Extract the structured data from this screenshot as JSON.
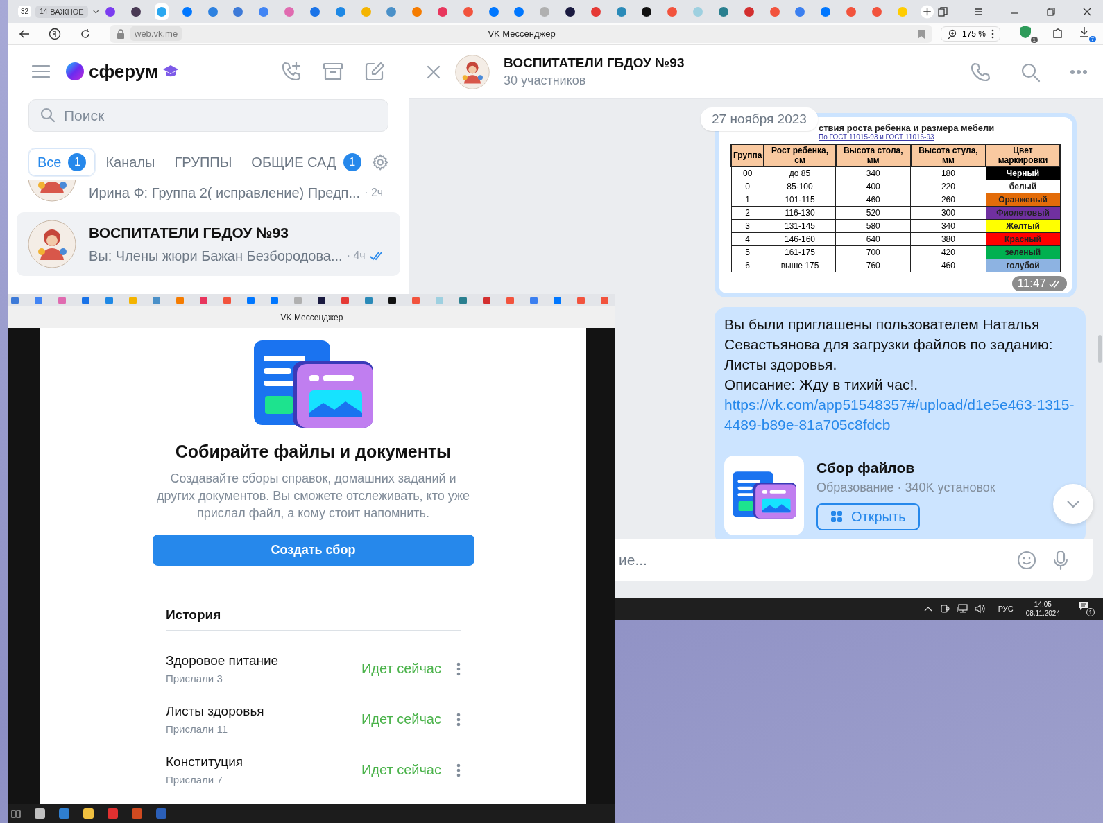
{
  "browser": {
    "tab_counter": "32",
    "tab_group": {
      "count": "14",
      "label": "ВАЖНОЕ"
    },
    "tabs": [
      {
        "color": "#7b3cf0",
        "selected": false
      },
      {
        "color": "#4a3a55",
        "selected": false
      },
      {
        "color": "#2aa7f0",
        "selected": true
      },
      {
        "color": "#0077ff",
        "selected": false
      },
      {
        "color": "#2d81e0",
        "selected": false
      },
      {
        "color": "#3d7ad8",
        "selected": false
      },
      {
        "color": "#4285f4",
        "selected": false
      },
      {
        "color": "#e06bb0",
        "selected": false
      },
      {
        "color": "#1a73e8",
        "selected": false
      },
      {
        "color": "#1e88e5",
        "selected": false
      },
      {
        "color": "#f4b400",
        "selected": false
      },
      {
        "color": "#4a90c8",
        "selected": false
      },
      {
        "color": "#f57c00",
        "selected": false
      },
      {
        "color": "#e8365d",
        "selected": false
      },
      {
        "color": "#f2533d",
        "selected": false
      },
      {
        "color": "#0077ff",
        "selected": false
      },
      {
        "color": "#0077ff",
        "selected": false
      },
      {
        "color": "#b0b0b0",
        "selected": false
      },
      {
        "color": "#1a1a40",
        "selected": false
      },
      {
        "color": "#e53935",
        "selected": false
      },
      {
        "color": "#2a8ab8",
        "selected": false
      },
      {
        "color": "#111111",
        "selected": false
      },
      {
        "color": "#f2533d",
        "selected": false
      },
      {
        "color": "#9ed0e0",
        "selected": false
      },
      {
        "color": "#2a7f8f",
        "selected": false
      },
      {
        "color": "#d32f2f",
        "selected": false
      },
      {
        "color": "#f2533d",
        "selected": false
      },
      {
        "color": "#3b7ff0",
        "selected": false
      },
      {
        "color": "#0077ff",
        "selected": false
      },
      {
        "color": "#f2533d",
        "selected": false
      },
      {
        "color": "#f2533d",
        "selected": false
      },
      {
        "color": "#ffcc00",
        "selected": false
      }
    ],
    "address": "web.vk.me",
    "page_title": "VK Мессенджер",
    "zoom": "175 %",
    "extension_badge": "1",
    "downloads_badge": "7"
  },
  "sidebar": {
    "logo": "сферум",
    "search": {
      "placeholder": "Поиск"
    },
    "filters": [
      {
        "label": "Все",
        "badge": "1",
        "selected": true
      },
      {
        "label": "Каналы",
        "selected": false
      },
      {
        "label": "ГРУППЫ",
        "selected": false
      },
      {
        "label": "ОБЩИЕ САД",
        "badge": "1",
        "selected": false
      }
    ],
    "chats": [
      {
        "kind": "partial",
        "text": "Ирина Ф: Группа 2( исправление) Предп...",
        "time": "· 2ч",
        "selected": false
      },
      {
        "kind": "full",
        "title": "ВОСПИТАТЕЛИ ГБДОУ №93",
        "text": "Вы: Члены жюри Бажан Безбородова...",
        "time": "· 4ч",
        "selected": true
      }
    ]
  },
  "chat": {
    "title": "ВОСПИТАТЕЛИ ГБДОУ №93",
    "subtitle": "30 участников",
    "date": "27 ноября 2023",
    "messages": [
      {
        "kind": "image",
        "heading": "ствия роста ребенка и размера мебели",
        "link": "По ГОСТ 11015-93 и ГОСТ 11016-93",
        "columns": [
          "Группа",
          "Рост ребенка, см",
          "Высота стола, мм",
          "Высота стула, мм",
          "Цвет маркировки"
        ],
        "rows": [
          {
            "cells": [
              "00",
              "до 85",
              "340",
              "180"
            ],
            "marking": "Черный",
            "color": "#000000"
          },
          {
            "cells": [
              "0",
              "85-100",
              "400",
              "220"
            ],
            "marking": "белый",
            "color": "#ffffff"
          },
          {
            "cells": [
              "1",
              "101-115",
              "460",
              "260"
            ],
            "marking": "Оранжевый",
            "color": "#e36c09"
          },
          {
            "cells": [
              "2",
              "116-130",
              "520",
              "300"
            ],
            "marking": "Фиолетовый",
            "color": "#7030a0"
          },
          {
            "cells": [
              "3",
              "131-145",
              "580",
              "340"
            ],
            "marking": "Желтый",
            "color": "#ffff00"
          },
          {
            "cells": [
              "4",
              "146-160",
              "640",
              "380"
            ],
            "marking": "Красный",
            "color": "#ff0000"
          },
          {
            "cells": [
              "5",
              "161-175",
              "700",
              "420"
            ],
            "marking": "зеленый",
            "color": "#00b050"
          },
          {
            "cells": [
              "6",
              "выше 175",
              "760",
              "460"
            ],
            "marking": "голубой",
            "color": "#8db3e2"
          }
        ],
        "time": "11:47"
      },
      {
        "kind": "invite",
        "paragraphs": [
          "Вы были приглашены пользователем Наталья Севастьянова для загрузки файлов по заданию: Листы здоровья.",
          "Описание: Жду в тихий час!."
        ],
        "link": "https://vk.com/app51548357#/upload/d1e5e463-1315-4489-b89e-81a705c8fdcb",
        "app": {
          "name": "Сбор файлов",
          "meta": "Образование · 340K установок",
          "button": "Открыть"
        }
      }
    ],
    "composer": {
      "placeholder": "ие..."
    }
  },
  "taskbar": {
    "language": "РУС",
    "time": "14:05",
    "date": "08.11.2024",
    "notifications": "1"
  },
  "overlay": {
    "page_title": "VK Мессенджер",
    "tabs": [
      {
        "color": "#3d7ad8"
      },
      {
        "color": "#4285f4"
      },
      {
        "color": "#e06bb0"
      },
      {
        "color": "#1a73e8"
      },
      {
        "color": "#1e88e5"
      },
      {
        "color": "#f4b400"
      },
      {
        "color": "#4a90c8"
      },
      {
        "color": "#f57c00"
      },
      {
        "color": "#e8365d"
      },
      {
        "color": "#f2533d"
      },
      {
        "color": "#0077ff"
      },
      {
        "color": "#0077ff"
      },
      {
        "color": "#b0b0b0"
      },
      {
        "color": "#1a1a40"
      },
      {
        "color": "#e53935"
      },
      {
        "color": "#2a8ab8"
      },
      {
        "color": "#111111"
      },
      {
        "color": "#f2533d"
      },
      {
        "color": "#9ed0e0"
      },
      {
        "color": "#2a7f8f"
      },
      {
        "color": "#d32f2f"
      },
      {
        "color": "#f2533d"
      },
      {
        "color": "#3b7ff0"
      },
      {
        "color": "#0077ff"
      },
      {
        "color": "#f2533d"
      },
      {
        "color": "#f2533d"
      }
    ],
    "modal": {
      "title": "Собирайте файлы и документы",
      "description": "Создавайте сборы справок, домашних заданий и других документов. Вы сможете отслеживать, кто уже прислал файл, а кому стоит напомнить.",
      "button": "Создать сбор",
      "history_title": "История",
      "history": [
        {
          "name": "Здоровое питание",
          "sent": "Прислали 3",
          "status": "Идет сейчас"
        },
        {
          "name": "Листы здоровья",
          "sent": "Прислали 11",
          "status": "Идет сейчас"
        },
        {
          "name": "Конституция",
          "sent": "Прислали 7",
          "status": "Идет сейчас"
        }
      ]
    },
    "taskbar_apps": [
      {
        "color": "#c0c0c0"
      },
      {
        "color": "#2f7fd0"
      },
      {
        "color": "#f0c040"
      },
      {
        "color": "#e03030"
      },
      {
        "color": "#d04a20"
      },
      {
        "color": "#2b5fb8"
      }
    ]
  }
}
